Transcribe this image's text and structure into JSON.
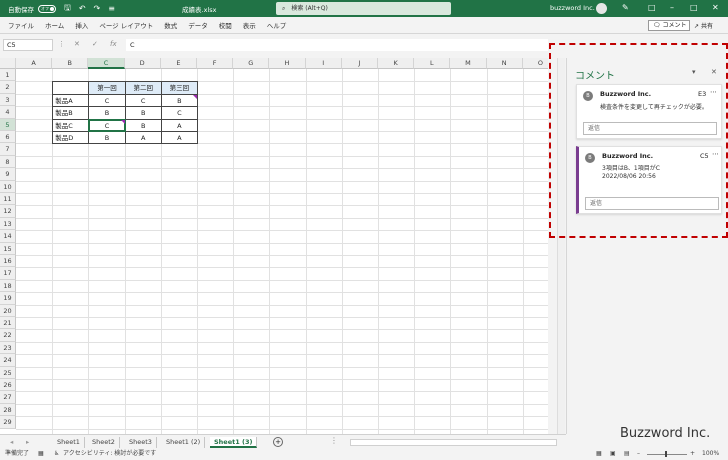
{
  "titlebar": {
    "autosave_label": "自動保存",
    "autosave_state": "オフ",
    "filename": "成績表.xlsx",
    "search_placeholder": "検索 (Alt+Q)",
    "user": "buzzword Inc."
  },
  "ribbon": {
    "tabs": [
      "ファイル",
      "ホーム",
      "挿入",
      "ページ レイアウト",
      "数式",
      "データ",
      "校閲",
      "表示",
      "ヘルプ"
    ],
    "comment_button": "コメント",
    "share_button": "共有"
  },
  "formula_bar": {
    "name_box": "C5",
    "formula": "C"
  },
  "columns": [
    "A",
    "B",
    "C",
    "D",
    "E",
    "F",
    "G",
    "H",
    "I",
    "J",
    "K",
    "L",
    "M",
    "N",
    "O"
  ],
  "rows": [
    "1",
    "2",
    "3",
    "4",
    "5",
    "6",
    "7",
    "8",
    "9",
    "10",
    "11",
    "12",
    "13",
    "14",
    "15",
    "16",
    "17",
    "18",
    "19",
    "20",
    "21",
    "22",
    "23",
    "24",
    "25",
    "26",
    "27",
    "28",
    "29"
  ],
  "table": {
    "headers": [
      "第一回",
      "第二回",
      "第三回"
    ],
    "rows": [
      {
        "label": "製品A",
        "values": [
          "C",
          "C",
          "B"
        ]
      },
      {
        "label": "製品B",
        "values": [
          "B",
          "B",
          "C"
        ]
      },
      {
        "label": "製品C",
        "values": [
          "C",
          "B",
          "A"
        ]
      },
      {
        "label": "製品D",
        "values": [
          "B",
          "A",
          "A"
        ]
      }
    ]
  },
  "sheets": [
    "Sheet1",
    "Sheet2",
    "Sheet3",
    "Sheet1 (2)",
    "Sheet1 (3)"
  ],
  "active_sheet": "Sheet1 (3)",
  "status": {
    "ready": "準備完了",
    "accessibility": "アクセシビリティ: 検討が必要です",
    "zoom": "100%"
  },
  "comment_pane": {
    "title": "コメント",
    "comments": [
      {
        "initial": "B",
        "author": "Buzzword Inc.",
        "cell": "E3",
        "text": "検査条件を変更して再チェックが必要。",
        "date": "",
        "reply_placeholder": "返信"
      },
      {
        "initial": "B",
        "author": "Buzzword Inc.",
        "cell": "C5",
        "text": "3項目はB、1項目がC",
        "date": "2022/08/06 20:56",
        "reply_placeholder": "返信"
      }
    ]
  },
  "watermark": "Buzzword Inc.",
  "colors": {
    "excel_green": "#217346",
    "comment_accent": "#7a3d90",
    "highlight_box": "#c00000"
  }
}
